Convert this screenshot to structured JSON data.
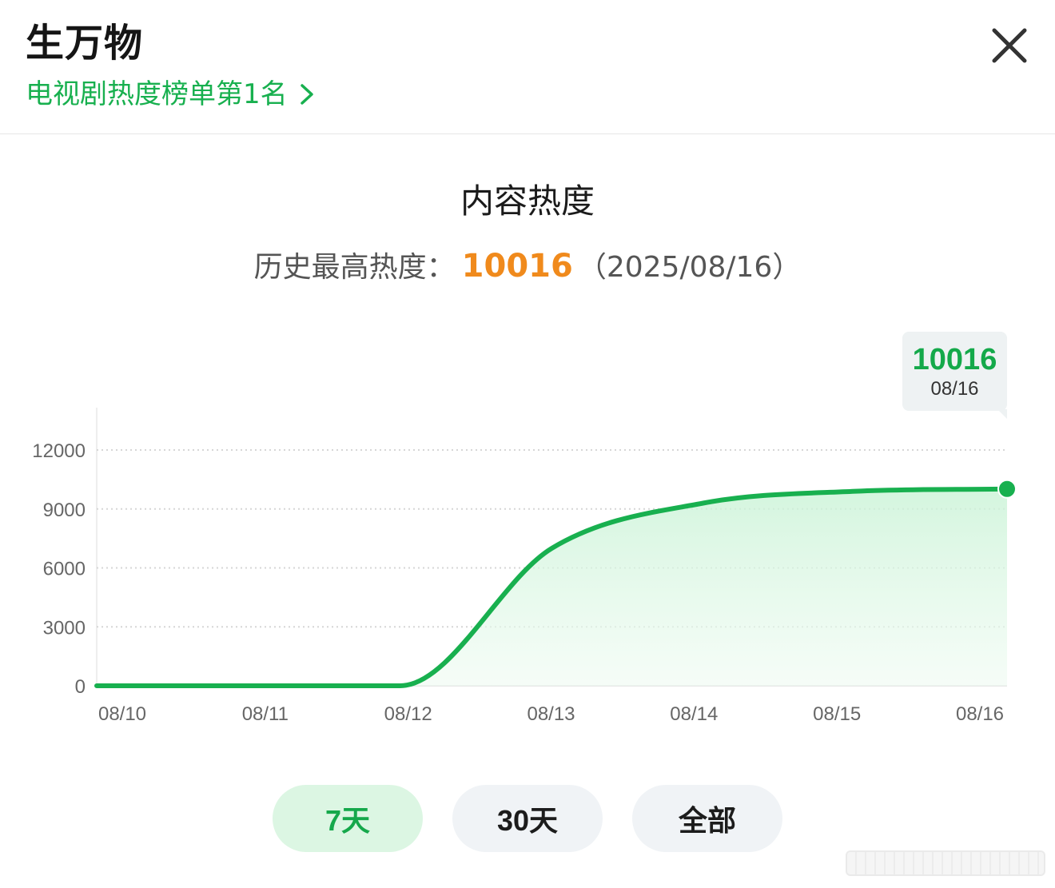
{
  "header": {
    "title": "生万物",
    "rank_link": "电视剧热度榜单第1名"
  },
  "icons": {
    "close": "close-icon",
    "rank_chevron": "chevron-right-icon"
  },
  "colors": {
    "accent_green": "#18b04f",
    "peak_orange": "#f08a1c",
    "active_chip_bg": "#dcf6e3",
    "chip_bg": "#f0f3f6"
  },
  "section": {
    "title": "内容热度",
    "history_prefix": "历史最高热度：",
    "history_peak": "10016",
    "history_date": "（2025/08/16）"
  },
  "tooltip": {
    "value": "10016",
    "date": "08/16"
  },
  "range_tabs": [
    {
      "label": "7天",
      "active": true
    },
    {
      "label": "30天",
      "active": false
    },
    {
      "label": "全部",
      "active": false
    }
  ],
  "chart_data": {
    "type": "area",
    "title": "",
    "xlabel": "",
    "ylabel": "",
    "categories": [
      "08/10",
      "08/11",
      "08/12",
      "08/13",
      "08/14",
      "08/15",
      "08/16"
    ],
    "series": [
      {
        "values": [
          0,
          0,
          0,
          7000,
          9300,
          9900,
          10016
        ]
      }
    ],
    "y_ticks": [
      "0",
      "3000",
      "6000",
      "9000",
      "12000"
    ],
    "ylim": [
      0,
      12000
    ],
    "grid": true,
    "highlight": {
      "category": "08/16",
      "value": 10016
    },
    "color": "#18b04f"
  }
}
